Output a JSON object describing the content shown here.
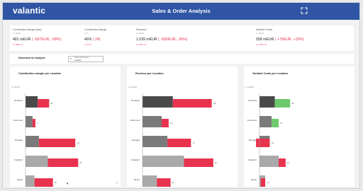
{
  "app": {
    "logo": "valantic",
    "title": "Sales & Order Analysis",
    "fullscreen_icon": "fullscreen-icon"
  },
  "kpis": [
    {
      "label": "Contribution Margin (abs)",
      "sub": "in mEUR",
      "value": "481 mEUR",
      "delta": "( -657EUR, -58%)",
      "dev": "▼ -59% -%"
    },
    {
      "label": "Contribution Margin",
      "sub": "in %",
      "value": "46%",
      "delta": "( 24)",
      "dev": "▲ 24 %"
    },
    {
      "label": "Revenue",
      "sub": "in mEUR",
      "value": "1,039 mEUR",
      "delta": "( -582EUR, -36%)",
      "dev": "▼ -36% -%"
    },
    {
      "label": "Variable Costs",
      "sub": "in mEUR",
      "value": "558 mEUR",
      "delta": "( +75EUR, +15%)",
      "dev": "▲ +15% -%"
    }
  ],
  "dimension": {
    "label": "Dimension for Analysis",
    "select_title": "Select Dimension",
    "select_value": "Location"
  },
  "panels": [
    {
      "title": "Contribution margin per Location",
      "unit": "in mEUR"
    },
    {
      "title": "Revenue per Location",
      "unit": "in mEUR"
    },
    {
      "title": "Variable Costs per Location",
      "unit": "in mEUR"
    }
  ],
  "colors": {
    "topbar": "#2f55a4",
    "negative": "#e8334f",
    "positive": "#6cc96b",
    "grey_dark": "#4a4a4a",
    "grey_mid": "#7a7a7a",
    "grey_light": "#a9a9a9"
  },
  "chart_data": [
    {
      "type": "bar",
      "title": "Contribution margin per Location",
      "ylabel": "in mEUR",
      "categories": [
        "Duisburg",
        "Dortmund",
        "Stuttgart",
        "Frankfurt",
        "Berlin"
      ],
      "series": [
        {
          "role": "base",
          "values": [
            38,
            22,
            42,
            70,
            28
          ]
        },
        {
          "role": "delta",
          "values": [
            36,
            9,
            114,
            95,
            58
          ]
        }
      ],
      "value_labels": [
        "",
        "",
        "",
        "",
        ""
      ]
    },
    {
      "type": "bar",
      "title": "Revenue per Location",
      "ylabel": "in mEUR",
      "categories": [
        "Duisburg",
        "Dortmund",
        "Stuttgart",
        "Frankfurt",
        "Berlin"
      ],
      "series": [
        {
          "role": "base",
          "values": [
            95,
            60,
            78,
            130,
            45
          ]
        },
        {
          "role": "delta",
          "values": [
            122,
            22,
            74,
            92,
            43
          ]
        }
      ]
    },
    {
      "type": "bar",
      "title": "Variable Costs per Location",
      "ylabel": "in mEUR",
      "categories": [
        "Duisburg",
        "Dortmund",
        "Stuttgart",
        "Frankfurt",
        "Berlin"
      ],
      "series": [
        {
          "role": "base",
          "values": [
            48,
            38,
            32,
            60,
            18
          ]
        },
        {
          "role": "delta",
          "values": [
            48,
            22,
            -43,
            22,
            -14
          ]
        }
      ]
    }
  ]
}
